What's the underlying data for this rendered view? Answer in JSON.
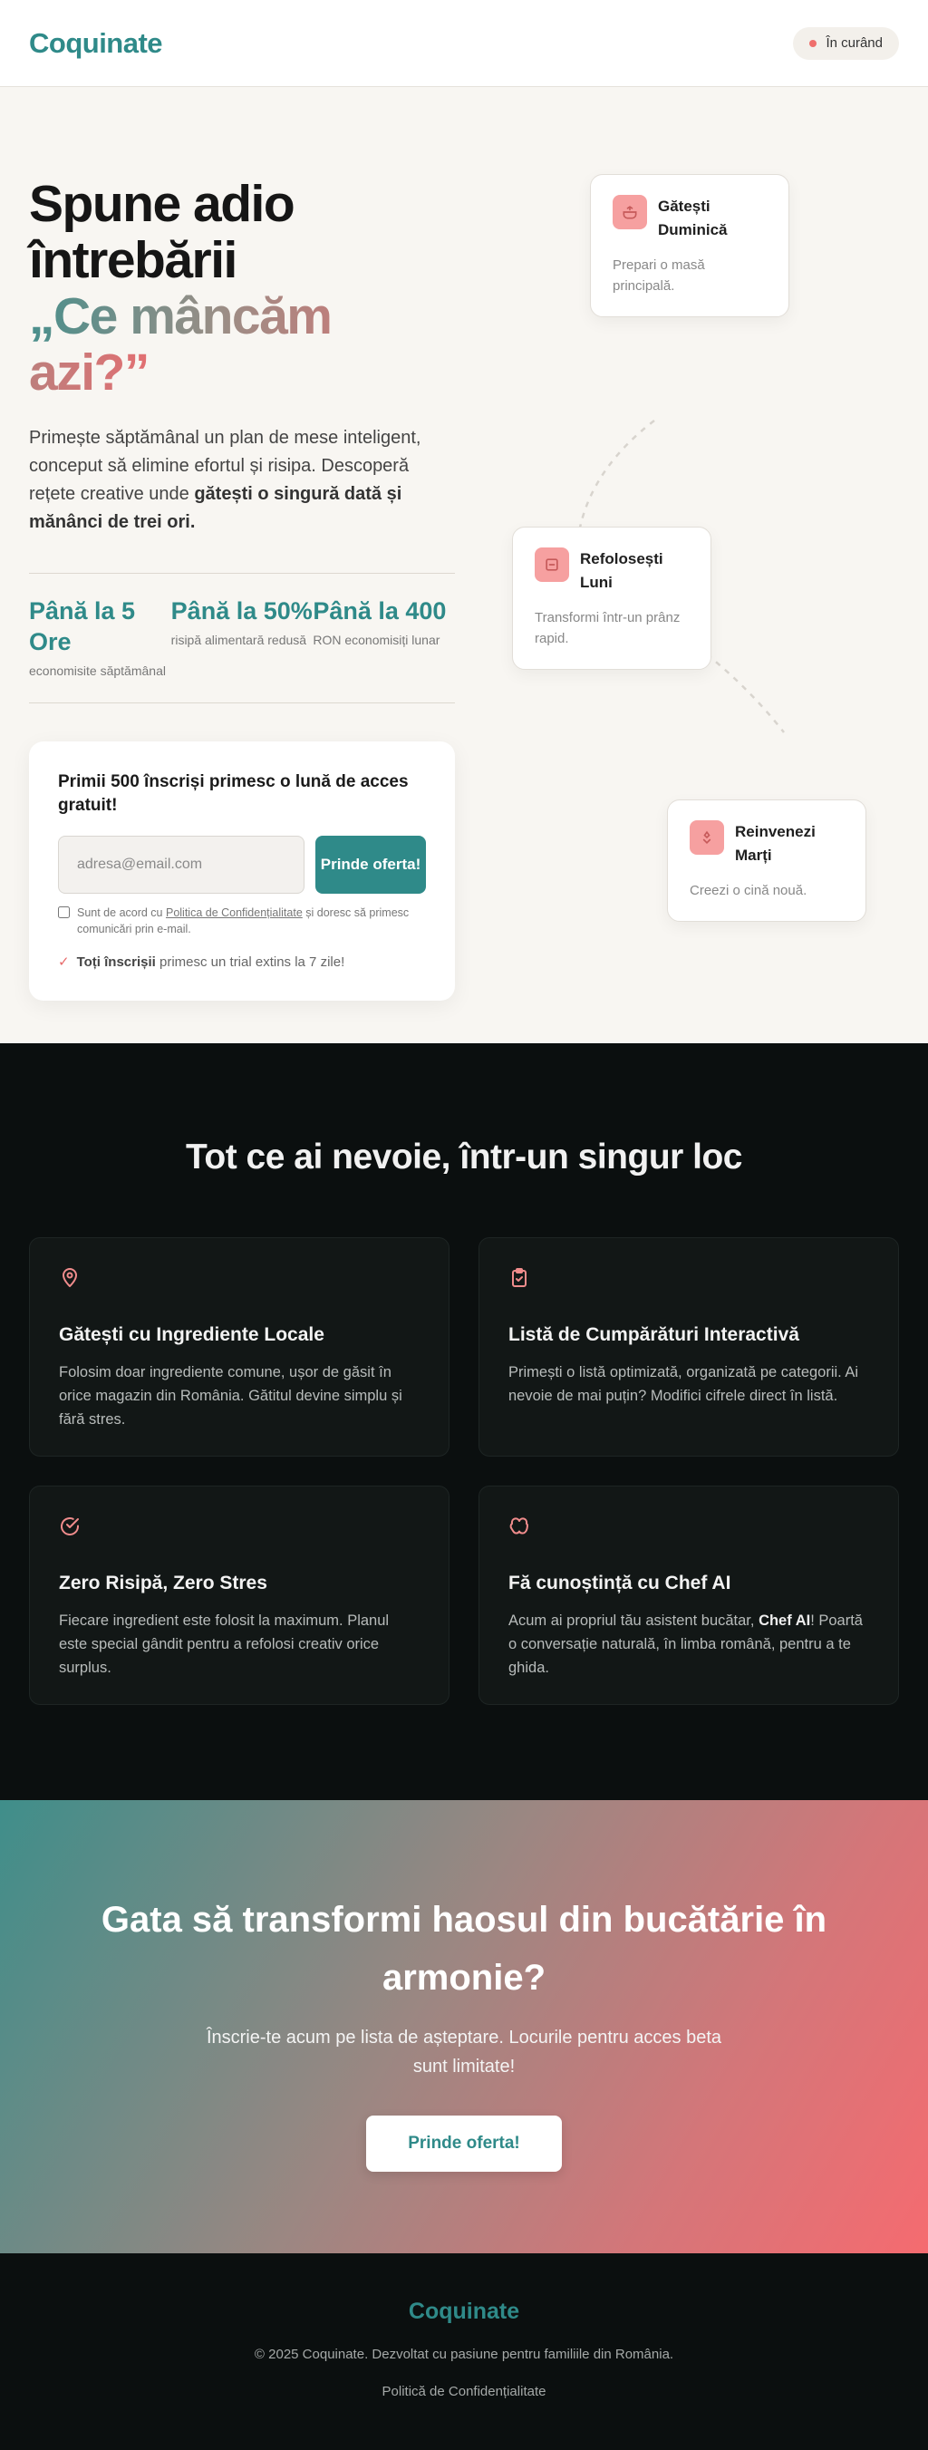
{
  "header": {
    "logo": "Coquinate",
    "badge": "În curând"
  },
  "hero": {
    "title_line1": "Spune adio",
    "title_line2": "întrebării",
    "title_accent": "„Ce mâncăm azi?”",
    "desc_plain": "Primește săptămânal un plan de mese inteligent, conceput să elimine efortul și risipa. Descoperă rețete creative unde ",
    "desc_bold": "gătești o singură dată și mănânci de trei ori.",
    "stats": [
      {
        "value": "Până la 5 Ore",
        "label": "economisite săptămânal"
      },
      {
        "value": "Până la 50%",
        "label": "risipă alimentară redusă"
      },
      {
        "value": "Până la 400",
        "label": "RON economisiți lunar"
      }
    ],
    "signup": {
      "title": "Primii 500 înscriși primesc o lună de acces gratuit!",
      "email_placeholder": "adresa@email.com",
      "button": "Prinde oferta!",
      "consent_pre": "Sunt de acord cu ",
      "consent_link": "Politica de Confidențialitate",
      "consent_post": " și doresc să primesc comunicări prin e-mail.",
      "trial_bold": "Toți înscrișii",
      "trial_rest": " primesc un trial extins la 7 zile!"
    },
    "cards": [
      {
        "title": "Gătești Duminică",
        "desc": "Prepari o masă principală.",
        "icon": "cooking-pot-icon"
      },
      {
        "title": "Refolosești Luni",
        "desc": "Transformi într-un prânz rapid.",
        "icon": "container-icon"
      },
      {
        "title": "Reinvenezi Marți",
        "desc": "Creezi o cină nouă.",
        "icon": "sparkle-icon"
      }
    ]
  },
  "features": {
    "title": "Tot ce ai nevoie, într-un singur loc",
    "items": [
      {
        "title": "Gătești cu Ingrediente Locale",
        "desc": "Folosim doar ingrediente comune, ușor de găsit în orice magazin din România. Gătitul devine simplu și fără stres.",
        "icon": "map-pin-icon"
      },
      {
        "title": "Listă de Cumpărături Interactivă",
        "desc": "Primești o listă optimizată, organizată pe categorii. Ai nevoie de mai puțin? Modifici cifrele direct în listă.",
        "icon": "clipboard-check-icon"
      },
      {
        "title": "Zero Risipă, Zero Stres",
        "desc": "Fiecare ingredient este folosit la maximum. Planul este special gândit pentru a refolosi creativ orice surplus.",
        "icon": "check-circle-icon"
      },
      {
        "title": "Fă cunoștință cu Chef AI",
        "desc_pre": "Acum ai propriul tău asistent bucătar, ",
        "desc_bold": "Chef AI",
        "desc_post": "! Poartă o conversație naturală, în limba română, pentru a te ghida.",
        "icon": "brain-icon"
      }
    ]
  },
  "cta": {
    "title": "Gata să transformi haosul din bucătărie în armonie?",
    "desc": "Înscrie-te acum pe lista de așteptare. Locurile pentru acces beta sunt limitate!",
    "button": "Prinde oferta!"
  },
  "footer": {
    "logo": "Coquinate",
    "copyright": "© 2025 Coquinate. Dezvoltat cu pasiune pentru familiile din România.",
    "privacy_link": "Politică de Confidențialitate"
  },
  "colors": {
    "brand": "#2f8a89",
    "accent": "#ef6f6c",
    "dark_bg": "#0b0f0f",
    "hero_bg": "#f8f6f2"
  }
}
